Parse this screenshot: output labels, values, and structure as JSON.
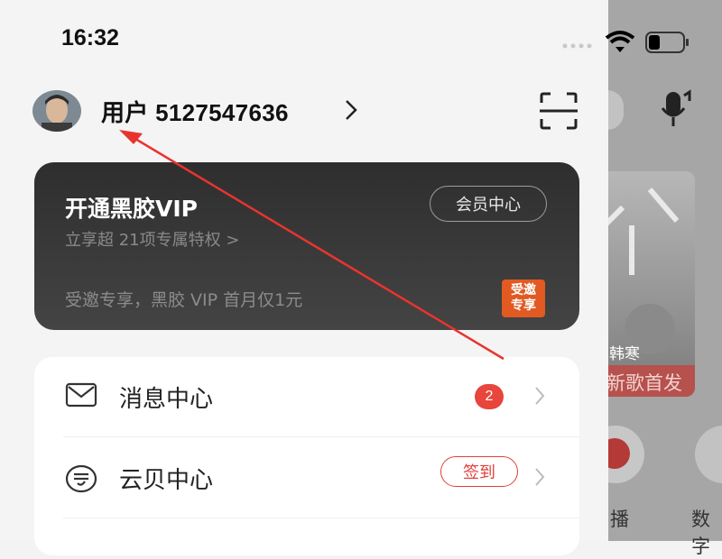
{
  "status_bar": {
    "time": "16:32"
  },
  "user": {
    "name": "用户 5127547636"
  },
  "vip_card": {
    "title": "开通黑胶VIP",
    "subtitle": "立享超 21项专属特权 >",
    "member_center_label": "会员中心",
    "promo_text": "受邀专享，黑胶 VIP 首月仅1元",
    "invite_badge_line1": "受邀",
    "invite_badge_line2": "专享"
  },
  "menu": {
    "items": [
      {
        "label": "消息中心",
        "badge": "2",
        "icon": "mail-icon"
      },
      {
        "label": "云贝中心",
        "action_label": "签到",
        "icon": "coin-icon"
      }
    ]
  },
  "background_app": {
    "card_artist": "韩寒",
    "card_banner": "新歌首发",
    "label_1": "播",
    "label_2": "数字"
  },
  "colors": {
    "accent_red": "#e8453c",
    "vip_bg": "#333333",
    "invite_orange": "#e05a22"
  }
}
